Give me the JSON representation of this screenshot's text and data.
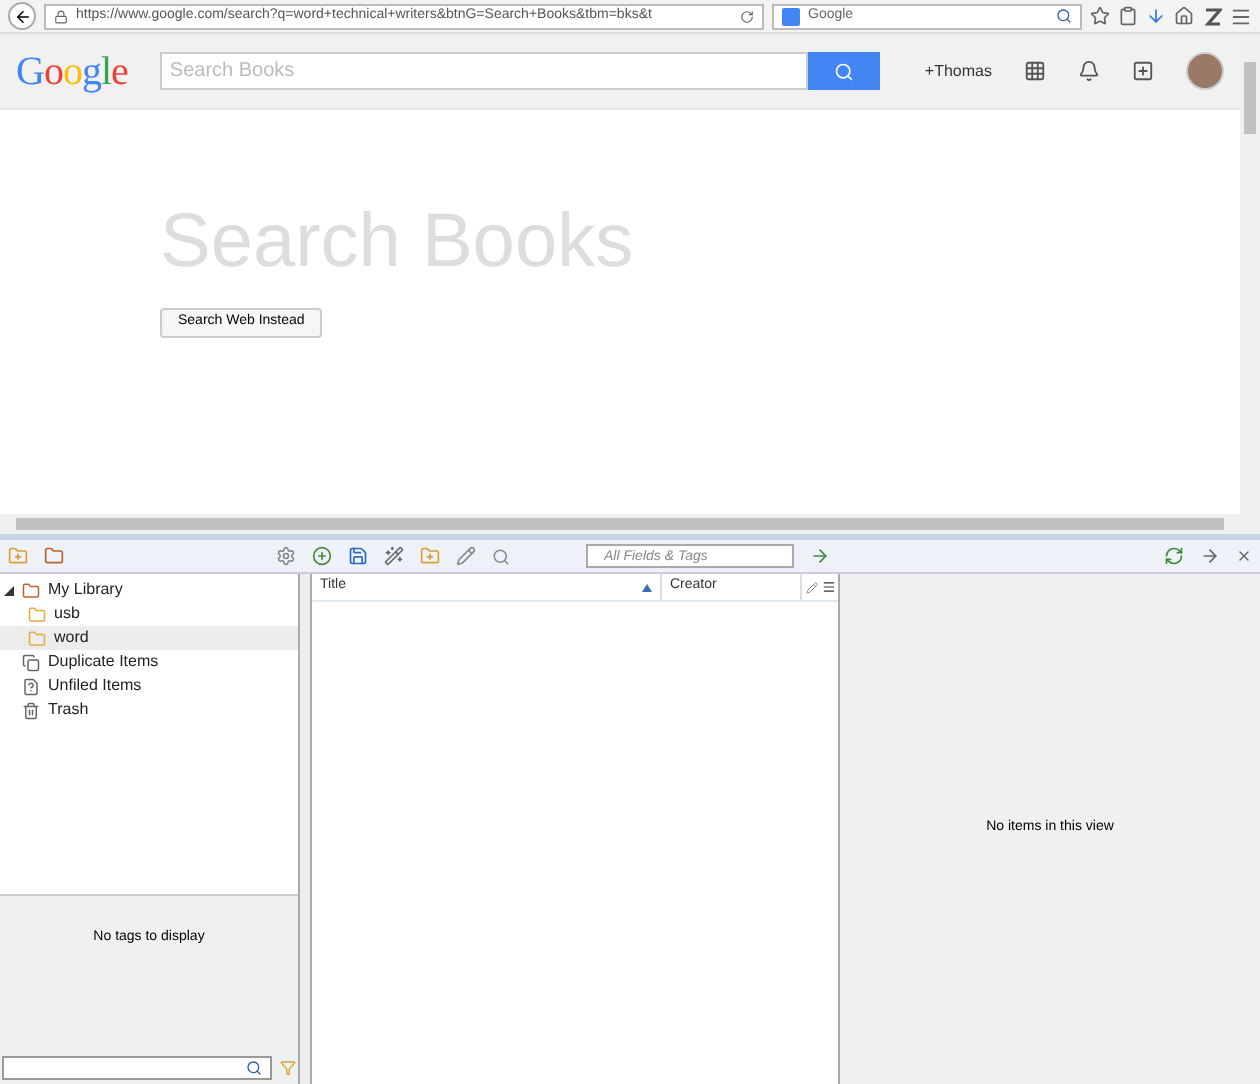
{
  "browser": {
    "url": "https://www.google.com/search?q=word+technical+writers&btnG=Search+Books&tbm=bks&t",
    "search_engine": "Google"
  },
  "google": {
    "logo": "Google",
    "search": {
      "placeholder": "Search Books"
    },
    "user": "+Thomas",
    "heading": "Search Books",
    "button": "Search Web Instead"
  },
  "zotero": {
    "search": {
      "placeholder": "All Fields & Tags"
    },
    "collections": [
      {
        "label": "My Library",
        "kind": "library",
        "selected": false,
        "children": [
          {
            "label": "usb",
            "kind": "folder",
            "selected": false
          },
          {
            "label": "word",
            "kind": "folder",
            "selected": true
          }
        ]
      },
      {
        "label": "Duplicate Items",
        "kind": "duplicates",
        "selected": false
      },
      {
        "label": "Unfiled Items",
        "kind": "unfiled",
        "selected": false
      },
      {
        "label": "Trash",
        "kind": "trash",
        "selected": false
      }
    ],
    "tags_message": "No tags to display",
    "columns": [
      {
        "label": "Title",
        "sorted": true
      },
      {
        "label": "Creator",
        "sorted": false
      }
    ],
    "item_message": "No items in this view"
  }
}
